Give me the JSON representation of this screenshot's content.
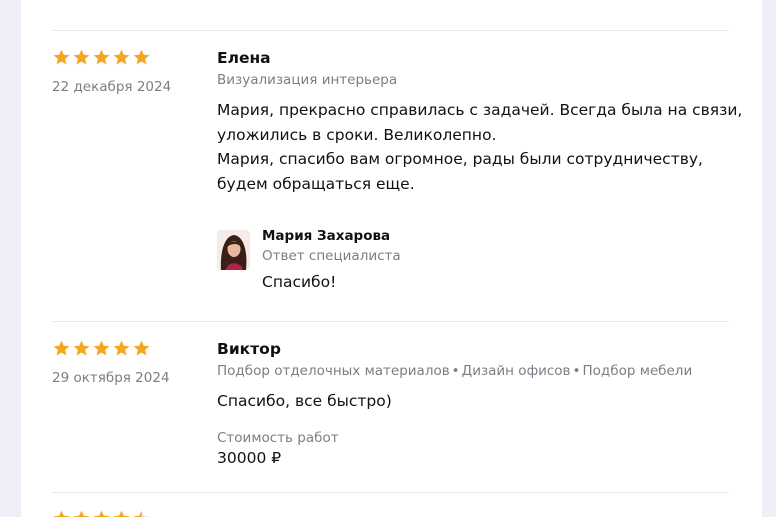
{
  "colors": {
    "star": "#f5a623",
    "muted": "#7d7d86",
    "divider": "#e6e6ea",
    "page_bg": "#eeeff6"
  },
  "reviews": [
    {
      "rating": 5,
      "date": "22 декабря 2024",
      "author": "Елена",
      "tags": [
        "Визуализация интерьера"
      ],
      "text_lines": [
        "Мария, прекрасно справилась с задачей. Всегда была на связи,",
        "уложились в сроки. Великолепно.",
        "Мария, спасибо вам огромное, рады были сотрудничеству,",
        "будем обращаться еще."
      ],
      "reply": {
        "name": "Мария Захарова",
        "role": "Ответ специалиста",
        "text": "Спасибо!"
      }
    },
    {
      "rating": 5,
      "date": "29 октября 2024",
      "author": "Виктор",
      "tags": [
        "Подбор отделочных материалов",
        "Дизайн офисов",
        "Подбор мебели"
      ],
      "tag_separator": "•",
      "text": "Спасибо, все быстро)",
      "cost_label": "Стоимость работ",
      "cost_value": "30000 ₽"
    },
    {
      "rating": 4.5
    }
  ]
}
